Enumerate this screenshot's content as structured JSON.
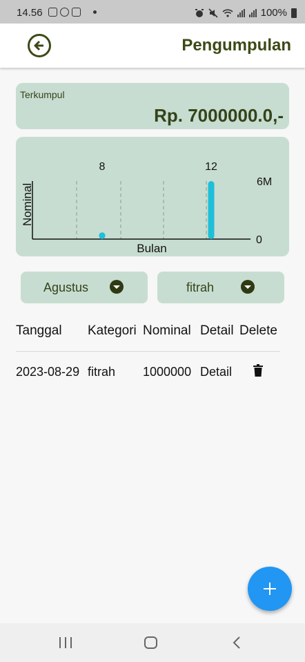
{
  "status_bar": {
    "time": "14.56",
    "battery": "100%",
    "icons": [
      "gallery-icon",
      "whatsapp-icon",
      "instagram-icon",
      "alarm-icon",
      "mute-icon",
      "wifi-icon",
      "signal-icon",
      "battery-icon"
    ]
  },
  "app_bar": {
    "title": "Pengumpulan",
    "back_icon": "back-arrow-circle-icon"
  },
  "summary": {
    "label": "Terkumpul",
    "value": "Rp. 7000000.0,-"
  },
  "chart_data": {
    "type": "bar",
    "x": [
      8,
      12
    ],
    "values": [
      700000,
      6000000
    ],
    "xlabel": "Bulan",
    "ylabel": "Nominal",
    "x_tick_labels": [
      "8",
      "12"
    ],
    "y_tick_labels": [
      "6M",
      "0"
    ],
    "ylim": [
      0,
      6000000
    ],
    "grid": "vertical dashed",
    "bar_color": "#1fbfd8"
  },
  "filters": {
    "month": "Agustus",
    "category": "fitrah"
  },
  "table": {
    "headers": [
      "Tanggal",
      "Kategori",
      "Nominal",
      "Detail",
      "Delete"
    ],
    "rows": [
      {
        "tanggal": "2023-08-29",
        "kategori": "fitrah",
        "nominal": "1000000",
        "detail": "Detail",
        "delete_icon": "trash-icon"
      }
    ]
  },
  "fab": {
    "icon": "plus-icon"
  },
  "nav_bar": {
    "icons": [
      "recents-icon",
      "home-icon",
      "back-icon"
    ]
  },
  "colors": {
    "accent": "#3b4a16",
    "card": "#c8ddd1",
    "fab": "#2196f3",
    "bar": "#1fbfd8"
  }
}
